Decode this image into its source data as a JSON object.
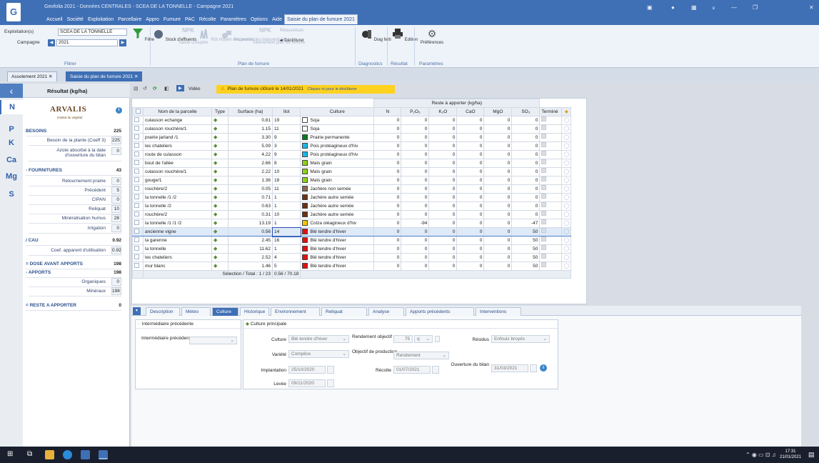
{
  "titlebar": {
    "title": "Geofolia 2021 - Données CENTRALES - SCEA DE LA TONNELLE - Campagne 2021"
  },
  "menu": [
    "Accueil",
    "Société",
    "Exploitation",
    "Parcellaire",
    "Appro",
    "Fumure",
    "PAC",
    "Récolte",
    "Paramètres",
    "Options",
    "Aide",
    "Saisie du plan de fumure 2021"
  ],
  "ribbon": {
    "filter": {
      "exploitation_label": "Exploitation(s)",
      "exploitation_value": "SCEA DE LA TONNELLE",
      "campagne_label": "Campagne",
      "campagne_value": "2021",
      "filtre_button": "Filtre",
      "group": "Filtrer"
    },
    "plan": {
      "buttons": [
        "Stock d'effluents",
        "Saisie Groupée",
        "Rdt moyen des prairies",
        "Reprendre les interventions",
        "Intervention plan de fumure",
        "Réouverture",
        "Déclôturer"
      ],
      "npk": "NPK",
      "group": "Plan de fumure"
    },
    "diag": {
      "button": "Diag ferti",
      "group": "Diagnostics"
    },
    "result": {
      "button": "Edition",
      "group": "Résultat"
    },
    "params": {
      "button": "Préférences",
      "group": "Paramètres"
    }
  },
  "doc_tabs": [
    "Assolement 2021",
    "Saisie du plan de fumure 2021"
  ],
  "left": {
    "title": "Résultat (kg/ha)",
    "nav": [
      "N",
      "P",
      "K",
      "Ca",
      "Mg",
      "S"
    ],
    "logo": "ARVALIS",
    "logo_sub": "Institut du végétal",
    "rows": [
      {
        "label": "BESOINS",
        "value": "225",
        "kind": "sec"
      },
      {
        "label": "Besoin de la plante (Coeff 3)",
        "value": "225",
        "kind": "sub"
      },
      {
        "label": "Azote absorbé à la date d'ouverture du bilan",
        "value": "0",
        "kind": "sub"
      },
      {
        "label": "- FOURNITURES",
        "value": "43",
        "kind": "sec"
      },
      {
        "label": "Retournement prairie",
        "value": "0",
        "kind": "sub"
      },
      {
        "label": "Précédent",
        "value": "5",
        "kind": "sub"
      },
      {
        "label": "CIPAN",
        "value": "0",
        "kind": "sub"
      },
      {
        "label": "Reliquat",
        "value": "10",
        "kind": "sub"
      },
      {
        "label": "Minéralisation humus",
        "value": "28",
        "kind": "sub"
      },
      {
        "label": "Irrigation",
        "value": "0",
        "kind": "sub"
      },
      {
        "label": "/ CAU",
        "value": "0.92",
        "kind": "sec"
      },
      {
        "label": "Coef. apparent d'utilisation",
        "value": "0.92",
        "kind": "sub"
      },
      {
        "label": "= DOSE AVANT APPORTS",
        "value": "198",
        "kind": "sec"
      },
      {
        "label": "- APPORTS",
        "value": "198",
        "kind": "sec"
      },
      {
        "label": "Organiques",
        "value": "0",
        "kind": "sub"
      },
      {
        "label": "Minéraux",
        "value": "198",
        "kind": "sub"
      },
      {
        "label": "= RESTE A APPORTER",
        "value": "0",
        "kind": "sec"
      }
    ]
  },
  "toolbar": {
    "video": "Vidéo"
  },
  "banner": {
    "text": "Plan de fumure clôturé le 14/01/2021",
    "link": "Cliquez ici pour le déclôturer"
  },
  "grid": {
    "group_header": "Reste à apporter (kg/ha)",
    "columns": [
      "Nom de la parcelle",
      "Type",
      "Surface (ha)",
      "Ilot",
      "Culture",
      "N",
      "P₂O₅",
      "K₂O",
      "CaO",
      "MgO",
      "SO₃",
      "Terminé"
    ],
    "rows": [
      [
        "culasson echange",
        "0.81",
        "19",
        "Soja",
        "#ffffff",
        "0",
        "0",
        "0",
        "0",
        "0",
        "0"
      ],
      [
        "culasson rouchère/1",
        "1.15",
        "11",
        "Soja",
        "#ffffff",
        "0",
        "0",
        "0",
        "0",
        "0",
        "0"
      ],
      [
        "prairie jarland /1",
        "3.30",
        "9",
        "Prairie permanente",
        "#0a7a1e",
        "0",
        "0",
        "0",
        "0",
        "0",
        "0"
      ],
      [
        "les chateliers",
        "5.09",
        "3",
        "Pois protéagineux d'hiv",
        "#19b8e6",
        "0",
        "0",
        "0",
        "0",
        "0",
        "0"
      ],
      [
        "route de culasson",
        "4.22",
        "9",
        "Pois protéagineux d'hiv",
        "#19b8e6",
        "0",
        "0",
        "0",
        "0",
        "0",
        "0"
      ],
      [
        "bout de l'allée",
        "2.66",
        "8",
        "Maïs grain",
        "#8fd11a",
        "0",
        "0",
        "0",
        "0",
        "0",
        "0"
      ],
      [
        "culasson rouchère/1",
        "2.22",
        "10",
        "Maïs grain",
        "#8fd11a",
        "0",
        "0",
        "0",
        "0",
        "0",
        "0"
      ],
      [
        "gouge/1",
        "1.36",
        "18",
        "Maïs grain",
        "#8fd11a",
        "0",
        "0",
        "0",
        "0",
        "0",
        "0"
      ],
      [
        "rouchère/2",
        "0.05",
        "11",
        "Jachère non semée",
        "#8a6a55",
        "0",
        "0",
        "0",
        "0",
        "0",
        "0"
      ],
      [
        "la tonnelle /1 /2",
        "0.71",
        "1",
        "Jachère autre semée",
        "#6b3210",
        "0",
        "0",
        "0",
        "0",
        "0",
        "0"
      ],
      [
        "la tonnelle /2",
        "0.63",
        "1",
        "Jachère autre semée",
        "#6b3210",
        "0",
        "0",
        "0",
        "0",
        "0",
        "0"
      ],
      [
        "rouchère/2",
        "0.31",
        "10",
        "Jachère autre semée",
        "#6b3210",
        "0",
        "0",
        "0",
        "0",
        "0",
        "0"
      ],
      [
        "la tonnelle /1 /1 /2",
        "13.19",
        "1",
        "Colza oléagineux d'hiv",
        "#f2c600",
        "0",
        "-94",
        "0",
        "0",
        "0",
        "-47"
      ],
      [
        "ancienne vigne",
        "0.56",
        "14",
        "Blé tendre d'hiver",
        "#e01010",
        "0",
        "0",
        "0",
        "0",
        "0",
        "50"
      ],
      [
        "la garenne",
        "2.45",
        "16",
        "Blé tendre d'hiver",
        "#e01010",
        "0",
        "0",
        "0",
        "0",
        "0",
        "50"
      ],
      [
        "la tonnelle",
        "11.62",
        "1",
        "Blé tendre d'hiver",
        "#e01010",
        "0",
        "0",
        "0",
        "0",
        "0",
        "50"
      ],
      [
        "les chateliers",
        "2.52",
        "4",
        "Blé tendre d'hiver",
        "#e01010",
        "0",
        "0",
        "0",
        "0",
        "0",
        "50"
      ],
      [
        "mur blanc",
        "1.46",
        "5",
        "Blé tendre d'hiver",
        "#e01010",
        "0",
        "0",
        "0",
        "0",
        "0",
        "50"
      ]
    ],
    "selected_row": 13,
    "footer_selection": "Sélection / Total : 1 / 23",
    "footer_surface": "0.56 / 70.18"
  },
  "bottom_tabs": [
    "Description",
    "Météo",
    "Culture",
    "Historique",
    "Environnement",
    "Reliquat",
    "Analyse",
    "Apports précédents",
    "Interventions"
  ],
  "active_bottom_tab": "Culture",
  "details": {
    "prev_title": "Intermédiaire précédente",
    "prev_label": "Intermédiaire précédente",
    "main_title": "Culture principale",
    "culture_label": "Culture",
    "culture_value": "Blé tendre d'hiver",
    "variete_label": "Variété",
    "variete_value": "Complice",
    "implantation_label": "Implantation",
    "implantation_value": "25/10/2020",
    "levee_label": "Levée",
    "levee_value": "09/11/2020",
    "rendement_label": "Rendement objectif",
    "rendement_value": "75",
    "rendement_unit": "q",
    "objectif_label": "Objectif de production",
    "objectif_value": "Rendement",
    "recolte_label": "Récolte",
    "recolte_value": "01/07/2021",
    "residus_label": "Résidus",
    "residus_value": "Enfouis broyés",
    "ouverture_label": "Ouverture du bilan",
    "ouverture_value": "31/03/2021"
  },
  "taskbar": {
    "time": "17:31",
    "date": "21/01/2021"
  }
}
